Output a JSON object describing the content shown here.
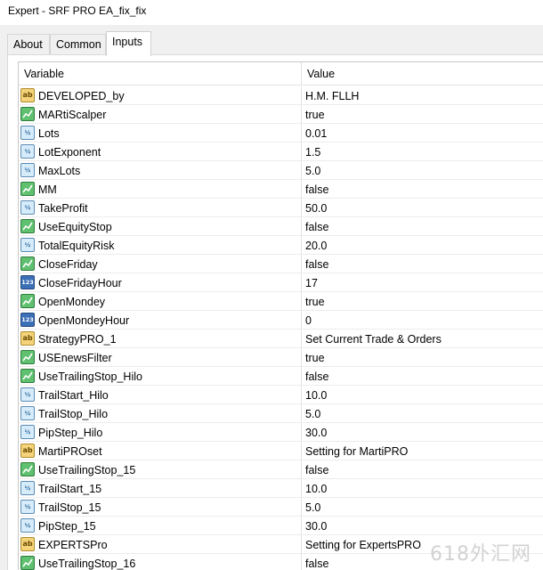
{
  "window": {
    "title": "Expert - SRF PRO EA_fix_fix"
  },
  "tabs": [
    {
      "label": "About"
    },
    {
      "label": "Common"
    },
    {
      "label": "Inputs"
    }
  ],
  "table": {
    "headers": {
      "variable": "Variable",
      "value": "Value"
    },
    "rows": [
      {
        "type": "string",
        "variable": "DEVELOPED_by",
        "value": "H.M. FLLH"
      },
      {
        "type": "bool",
        "variable": "MARtiScalper",
        "value": "true"
      },
      {
        "type": "double",
        "variable": "Lots",
        "value": "0.01"
      },
      {
        "type": "double",
        "variable": "LotExponent",
        "value": "1.5"
      },
      {
        "type": "double",
        "variable": "MaxLots",
        "value": "5.0"
      },
      {
        "type": "bool",
        "variable": "MM",
        "value": "false"
      },
      {
        "type": "double",
        "variable": "TakeProfit",
        "value": "50.0"
      },
      {
        "type": "bool",
        "variable": "UseEquityStop",
        "value": "false"
      },
      {
        "type": "double",
        "variable": "TotalEquityRisk",
        "value": "20.0"
      },
      {
        "type": "bool",
        "variable": "CloseFriday",
        "value": "false"
      },
      {
        "type": "int",
        "variable": "CloseFridayHour",
        "value": "17"
      },
      {
        "type": "bool",
        "variable": "OpenMondey",
        "value": "true"
      },
      {
        "type": "int",
        "variable": "OpenMondeyHour",
        "value": "0"
      },
      {
        "type": "string",
        "variable": "StrategyPRO_1",
        "value": "Set Current Trade & Orders"
      },
      {
        "type": "bool",
        "variable": "USEnewsFilter",
        "value": "true"
      },
      {
        "type": "bool",
        "variable": "UseTrailingStop_Hilo",
        "value": "false"
      },
      {
        "type": "double",
        "variable": "TrailStart_Hilo",
        "value": "10.0"
      },
      {
        "type": "double",
        "variable": "TrailStop_Hilo",
        "value": "5.0"
      },
      {
        "type": "double",
        "variable": "PipStep_Hilo",
        "value": "30.0"
      },
      {
        "type": "string",
        "variable": "MartiPROset",
        "value": "Setting for MartiPRO"
      },
      {
        "type": "bool",
        "variable": "UseTrailingStop_15",
        "value": "false"
      },
      {
        "type": "double",
        "variable": "TrailStart_15",
        "value": "10.0"
      },
      {
        "type": "double",
        "variable": "TrailStop_15",
        "value": "5.0"
      },
      {
        "type": "double",
        "variable": "PipStep_15",
        "value": "30.0"
      },
      {
        "type": "string",
        "variable": "EXPERTSPro",
        "value": "Setting for ExpertsPRO"
      },
      {
        "type": "bool",
        "variable": "UseTrailingStop_16",
        "value": "false"
      }
    ]
  },
  "icons": {
    "string": {
      "name": "string-type-icon",
      "glyph": "ab"
    },
    "bool": {
      "name": "bool-type-icon",
      "glyph": ""
    },
    "double": {
      "name": "double-type-icon",
      "glyph": "½"
    },
    "int": {
      "name": "int-type-icon",
      "glyph": "123"
    }
  },
  "watermark": "618外汇网"
}
